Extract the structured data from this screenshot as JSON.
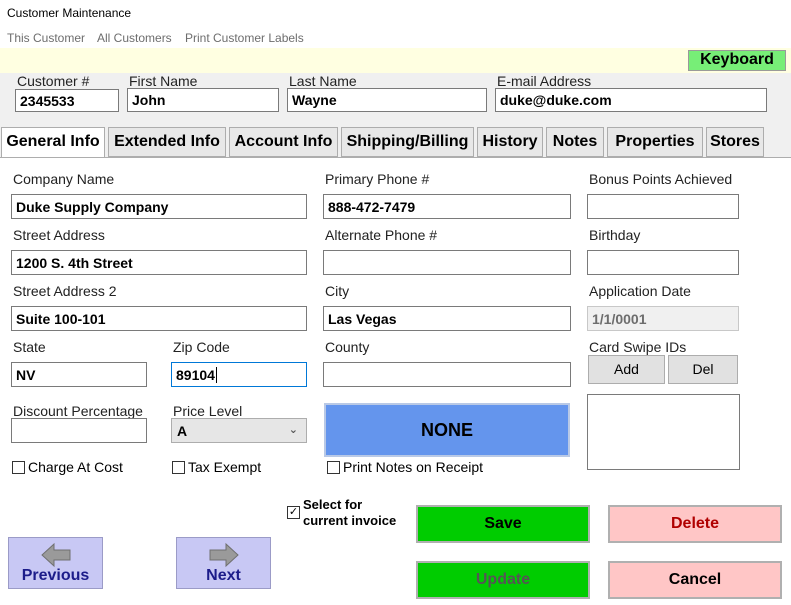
{
  "window": {
    "title": "Customer Maintenance"
  },
  "menu": {
    "items": [
      "This Customer",
      "All Customers",
      "Print Customer Labels"
    ]
  },
  "keyboard_button": "Keyboard",
  "header": {
    "customer_no": {
      "label": "Customer #",
      "value": "2345533"
    },
    "first_name": {
      "label": "First Name",
      "value": "John"
    },
    "last_name": {
      "label": "Last Name",
      "value": "Wayne"
    },
    "email": {
      "label": "E-mail Address",
      "value": "duke@duke.com"
    }
  },
  "tabs": [
    "General Info",
    "Extended Info",
    "Account Info",
    "Shipping/Billing",
    "History",
    "Notes",
    "Properties",
    "Stores"
  ],
  "active_tab": "General Info",
  "general": {
    "company_name": {
      "label": "Company Name",
      "value": "Duke Supply Company"
    },
    "street_address": {
      "label": "Street Address",
      "value": "1200 S. 4th Street"
    },
    "street_address2": {
      "label": "Street Address 2",
      "value": "Suite 100-101"
    },
    "state": {
      "label": "State",
      "value": "NV"
    },
    "zip": {
      "label": "Zip Code",
      "value": "89104"
    },
    "discount": {
      "label": "Discount Percentage",
      "value": ""
    },
    "price_level": {
      "label": "Price Level",
      "value": "A"
    },
    "charge_at_cost": {
      "label": "Charge At Cost",
      "checked": false
    },
    "tax_exempt": {
      "label": "Tax Exempt",
      "checked": false
    },
    "primary_phone": {
      "label": "Primary Phone #",
      "value": "888-472-7479"
    },
    "alt_phone": {
      "label": "Alternate Phone #",
      "value": ""
    },
    "city": {
      "label": "City",
      "value": "Las Vegas"
    },
    "county": {
      "label": "County",
      "value": ""
    },
    "status_button": "NONE",
    "print_notes": {
      "label": "Print Notes on Receipt",
      "checked": false
    },
    "bonus_points": {
      "label": "Bonus Points Achieved",
      "value": ""
    },
    "birthday": {
      "label": "Birthday",
      "value": ""
    },
    "application_date": {
      "label": "Application Date",
      "value": "1/1/0001"
    },
    "card_swipe": {
      "label": "Card Swipe IDs",
      "add": "Add",
      "del": "Del"
    }
  },
  "select_invoice": {
    "label_line1": "Select for",
    "label_line2": "current invoice",
    "checked": true
  },
  "buttons": {
    "previous": "Previous",
    "next": "Next",
    "save": "Save",
    "update": "Update",
    "delete": "Delete",
    "cancel": "Cancel"
  },
  "colors": {
    "green": "#00cc00",
    "pink": "#ffc6c6",
    "blue": "#6495ed",
    "nav": "#c8c8f4",
    "keyboard": "#77ee77"
  }
}
